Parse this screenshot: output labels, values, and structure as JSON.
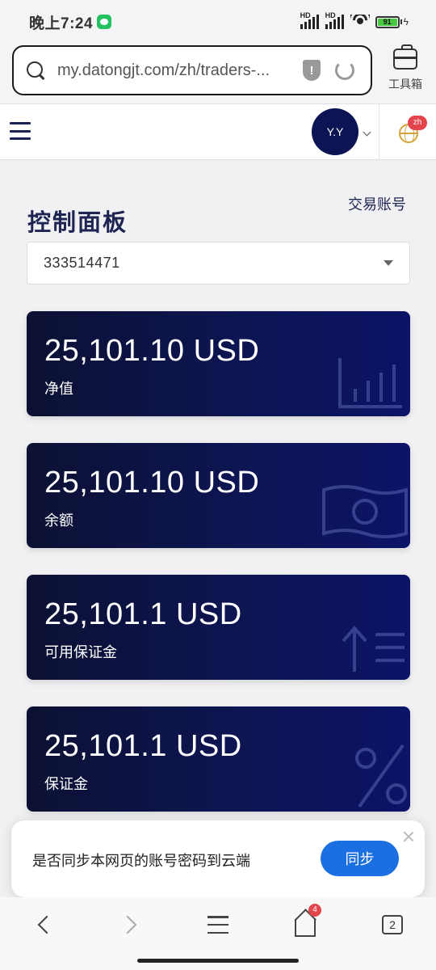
{
  "status_bar": {
    "time": "晚上7:24",
    "battery": "91",
    "signal_label_1": "HD",
    "signal_label_2": "HD"
  },
  "browser": {
    "url": "my.datongjt.com/zh/traders-...",
    "toolbox_label": "工具箱"
  },
  "header": {
    "avatar_initials": "Y.Y",
    "language_badge": "zh"
  },
  "main": {
    "title": "控制面板",
    "trade_account_link": "交易账号",
    "account_number": "333514471"
  },
  "cards": [
    {
      "amount": "25,101.10 USD",
      "label": "净值",
      "icon": "bar-chart-icon"
    },
    {
      "amount": "25,101.10 USD",
      "label": "余额",
      "icon": "banknote-icon"
    },
    {
      "amount": "25,101.1 USD",
      "label": "可用保证金",
      "icon": "upload-list-icon"
    },
    {
      "amount": "25,101.1 USD",
      "label": "保证金",
      "icon": "percent-icon"
    }
  ],
  "sync_popup": {
    "message": "是否同步本网页的账号密码到云端",
    "button": "同步"
  },
  "bottom_nav": {
    "home_badge": "4",
    "tab_count": "2"
  },
  "colors": {
    "brand_navy": "#0c1454",
    "accent_blue": "#1c6fe0",
    "badge_red": "#e4454c"
  }
}
